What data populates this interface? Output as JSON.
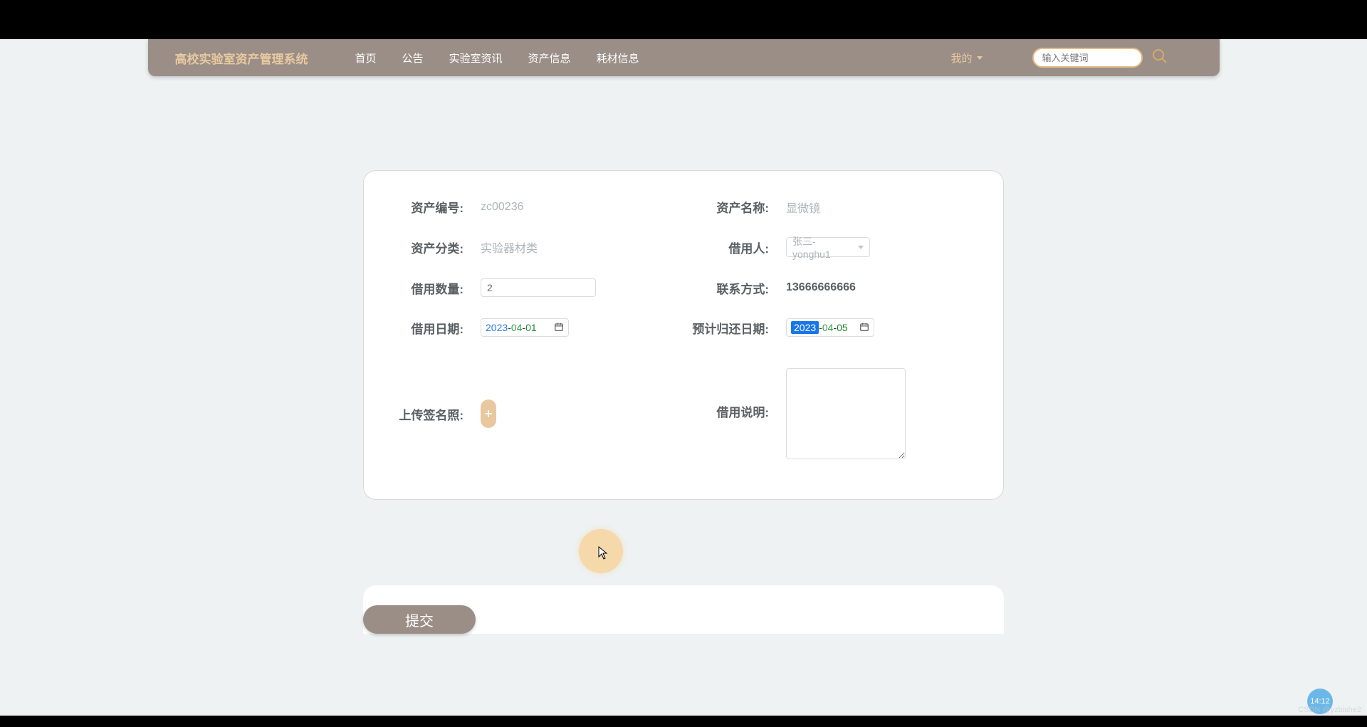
{
  "header": {
    "logo": "高校实验室资产管理系统",
    "nav": [
      "首页",
      "公告",
      "实验室资讯",
      "资产信息",
      "耗材信息"
    ],
    "my_menu": "我的",
    "search_placeholder": "输入关键词"
  },
  "form": {
    "asset_code_label": "资产编号:",
    "asset_code": "zc00236",
    "asset_name_label": "资产名称:",
    "asset_name": "显微镜",
    "asset_category_label": "资产分类:",
    "asset_category": "实验器材类",
    "borrower_label": "借用人:",
    "borrower": "张三-yonghu1",
    "borrow_qty_label": "借用数量:",
    "borrow_qty": "2",
    "contact_label": "联系方式:",
    "contact": "13666666666",
    "borrow_date_label": "借用日期:",
    "borrow_date_y": "2023",
    "borrow_date_m": "04",
    "borrow_date_d": "01",
    "return_date_label": "预计归还日期:",
    "return_date_y": "2023",
    "return_date_m": "04",
    "return_date_d": "05",
    "upload_label": "上传签名照:",
    "upload_plus": "+",
    "desc_label": "借用说明:"
  },
  "submit_label": "提交",
  "time_badge": "14:12",
  "watermark": "CSDN @yzbishe2"
}
